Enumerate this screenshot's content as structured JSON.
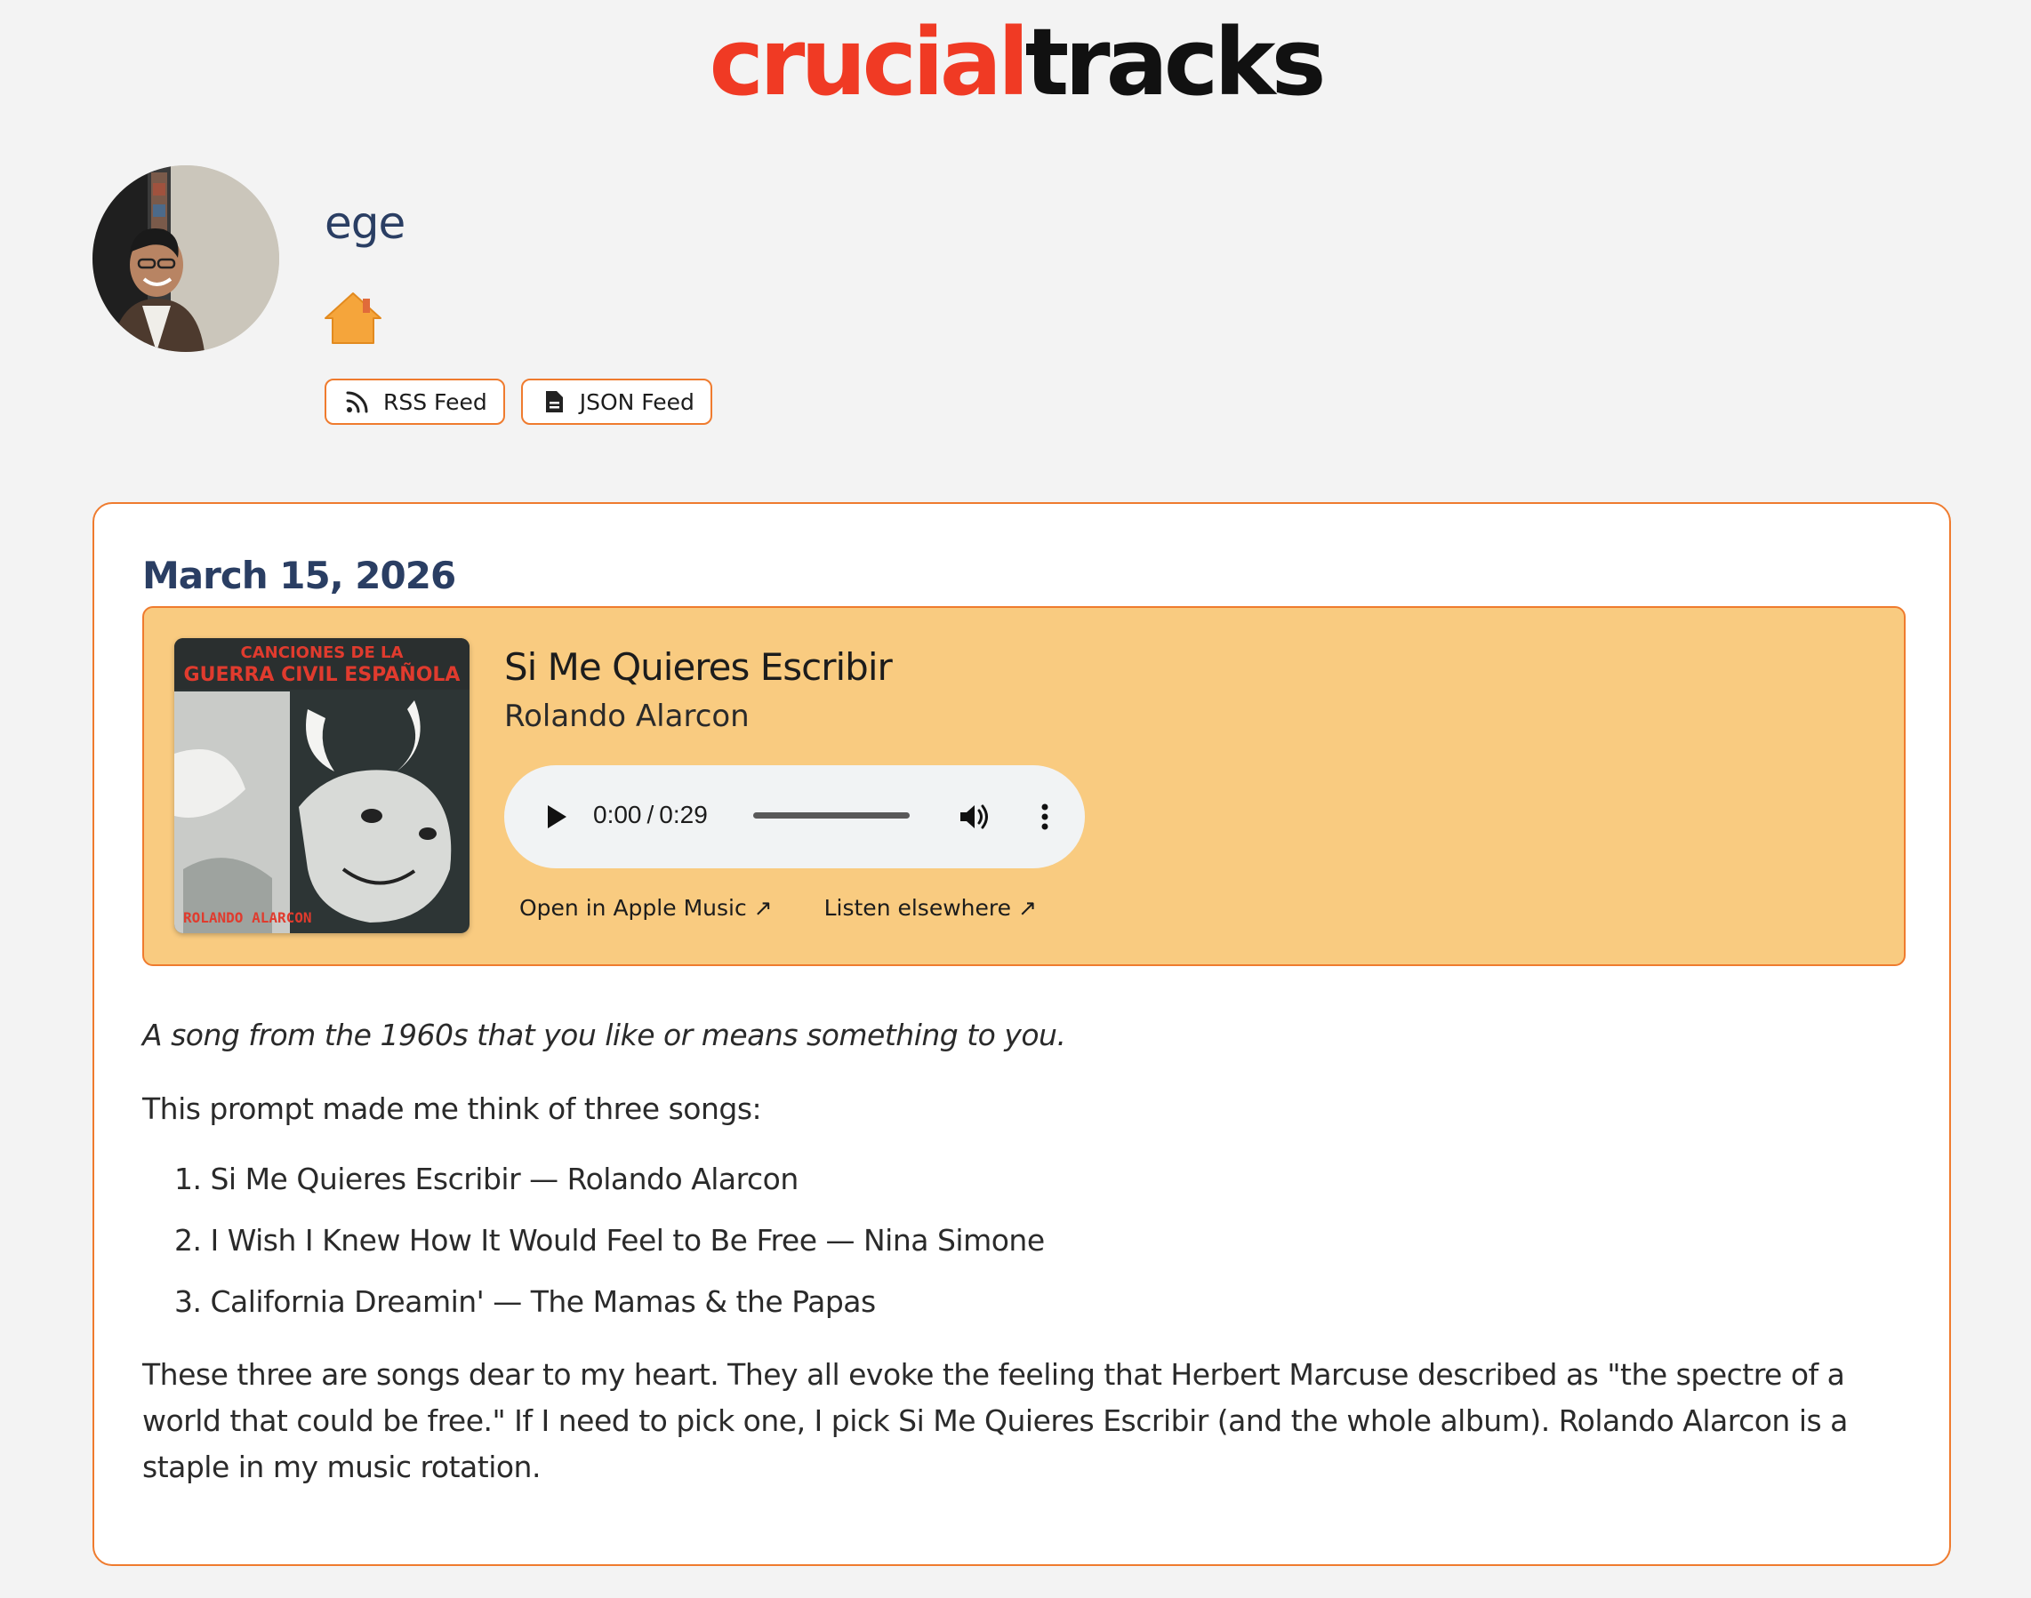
{
  "brand": {
    "logo_part_a": "crucial",
    "logo_part_b": "tracks",
    "accent_color": "#f03a24",
    "border_color": "#ef7b2e",
    "track_bg_color": "#f9cb80",
    "heading_color": "#2a3e63"
  },
  "profile": {
    "username": "ege",
    "home_icon": "home-icon",
    "feeds": [
      {
        "label": "RSS Feed",
        "icon": "rss-icon"
      },
      {
        "label": "JSON Feed",
        "icon": "document-icon"
      }
    ]
  },
  "post": {
    "date": "March 15, 2026",
    "track": {
      "title": "Si Me Quieres Escribir",
      "artist": "Rolando Alarcon",
      "player": {
        "current_time": "0:00",
        "separator": "/",
        "duration": "0:29",
        "progress": 0
      },
      "links": [
        {
          "label": "Open in Apple Music ↗"
        },
        {
          "label": "Listen elsewhere ↗"
        }
      ]
    },
    "prompt": "A song from the 1960s that you like or means something to you.",
    "intro": "This prompt made me think of three songs:",
    "songs": [
      "1. Si Me Quieres Escribir — Rolando Alarcon",
      "2. I Wish I Knew How It Would Feel to Be Free — Nina Simone",
      "3. California Dreamin' — The Mamas & the Papas"
    ],
    "closing": "These three are songs dear to my heart. They all evoke the feeling that Herbert Marcuse described as \"the spectre of a world that could be free.\" If I need to pick one, I pick Si Me Quieres Escribir (and the whole album). Rolando Alarcon is a staple in my music rotation."
  }
}
